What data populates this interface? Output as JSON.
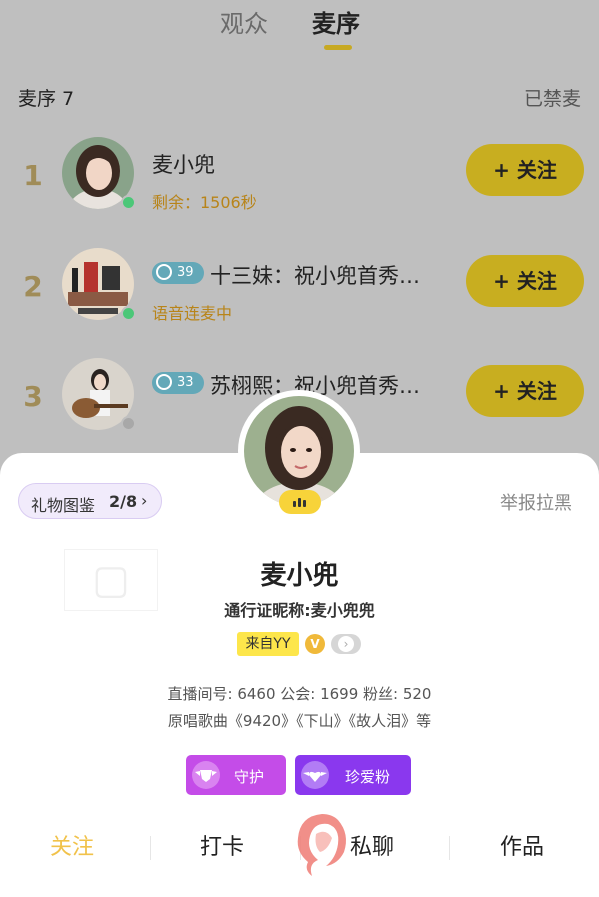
{
  "tabs": [
    {
      "label": "观众",
      "active": false
    },
    {
      "label": "麦序",
      "active": true
    }
  ],
  "queue": {
    "title": "麦序 7",
    "mute_label": "已禁麦",
    "follow_label": "+ 关注",
    "items": [
      {
        "rank": "1",
        "name": "麦小兜",
        "status": "剩余：1506秒",
        "online": true,
        "level": null
      },
      {
        "rank": "2",
        "name": "十三妹：祝小兜首秀…",
        "status": "语音连麦中",
        "online": true,
        "level": "39"
      },
      {
        "rank": "3",
        "name": "苏栩熙：祝小兜首秀…",
        "status": "",
        "online": false,
        "level": "33"
      }
    ]
  },
  "profile": {
    "gift_label": "礼物图鉴",
    "gift_count": "2/8",
    "report_label": "举报拉黑",
    "name": "麦小兜",
    "pass_name": "通行证昵称:麦小兜兜",
    "from_tag": "来自YY",
    "v_badge": "V",
    "stats": "直播间号: 6460  公会: 1699  粉丝: 520",
    "songs": "原唱歌曲《9420》《下山》《故人泪》等",
    "guard_label": "守护",
    "fan_label": "珍爱粉"
  },
  "bottom_bar": {
    "follow": "关注",
    "checkin": "打卡",
    "chat": "私聊",
    "works": "作品"
  },
  "colors": {
    "accent_yellow": "#c8ae20",
    "status_orange": "#b88419",
    "online_green": "#4cc778",
    "purple_guard": "#c44ce8",
    "purple_fan": "#8a38ee",
    "active_tab_yellow": "#f1c24a"
  },
  "icons": {
    "level_badge": "crown-icon",
    "speaking": "voice-bars-icon",
    "chevron": "chevron-right-icon",
    "guard": "shield-wing-icon",
    "fan": "heart-wing-icon"
  }
}
